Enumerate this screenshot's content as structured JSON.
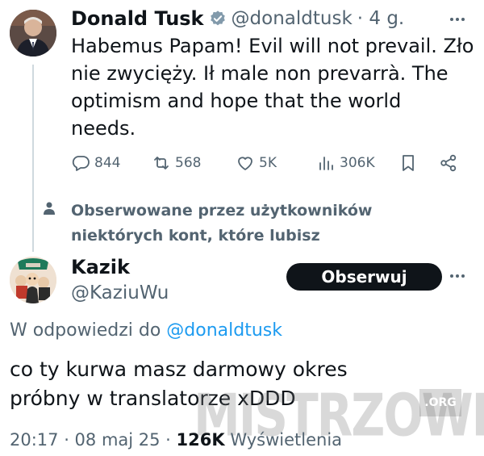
{
  "tweet": {
    "author_name": "Donald Tusk",
    "handle": "@donaldtusk",
    "time": "· 4 g.",
    "lines": [
      "Habemus Papam! Evil will not prevail. Zło",
      "nie zwycięży. Ił male non prevarrà. The",
      "optimism and hope that the world",
      "needs."
    ],
    "replies": "844",
    "retweets": "568",
    "likes": "5K",
    "views": "306K"
  },
  "social_context": {
    "lines": [
      "Obserwowane przez użytkowników",
      "niektórych kont, które lubisz"
    ]
  },
  "reply": {
    "author_name": "Kazik",
    "handle": "@KaziuWu",
    "follow_label": "Obserwuj",
    "reply_prefix": "W odpowiedzi do",
    "reply_handle": "@donaldtusk",
    "lines": [
      "co ty kurwa masz darmowy okres",
      "próbny w translatorze xDDD"
    ],
    "timestamp": "20:17 · 08 maj 25 ·",
    "views_count": "126K",
    "views_label": "Wyświetlenia"
  },
  "watermark": {
    "text": "MISTRZOWIE",
    "suffix": ".ORG"
  },
  "colors": {
    "link": "#1d9bf0",
    "verified": "#829aab",
    "muted": "#536471",
    "text": "#0f1419"
  },
  "icons": [
    "reply-icon",
    "retweet-icon",
    "like-icon",
    "views-icon",
    "bookmark-icon",
    "share-icon",
    "verified-icon",
    "more-icon",
    "person-icon"
  ]
}
